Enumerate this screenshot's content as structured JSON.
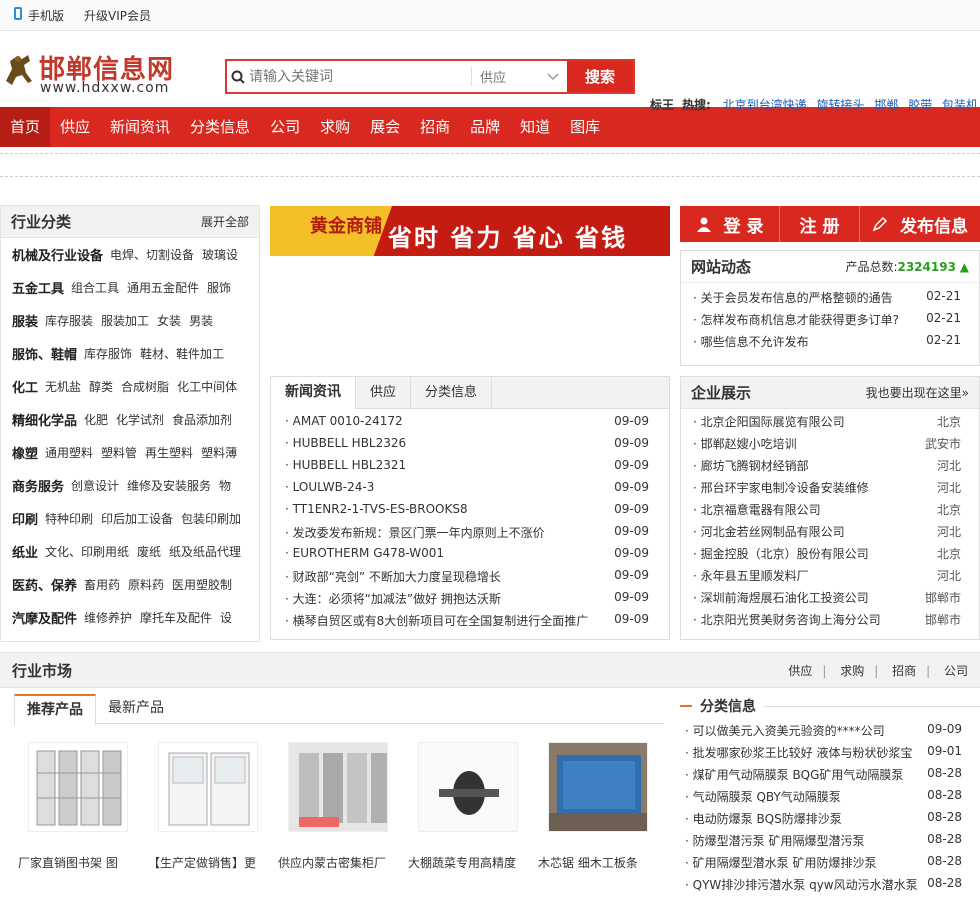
{
  "topbar": {
    "mobile": "手机版",
    "vip": "升级VIP会员"
  },
  "logo": {
    "title": "邯郸信息网",
    "domain": "www.hdxxw.com"
  },
  "search": {
    "placeholder": "请输入关键词",
    "scope": "供应",
    "button": "搜索"
  },
  "hot": {
    "label1": "标王",
    "label2": "热搜:",
    "keywords": [
      "北京到台湾快递",
      "旋转接头",
      "邯郸",
      "胶带",
      "包装机"
    ]
  },
  "nav": [
    "首页",
    "供应",
    "新闻资讯",
    "分类信息",
    "公司",
    "求购",
    "展会",
    "招商",
    "品牌",
    "知道",
    "图库"
  ],
  "categories": {
    "title": "行业分类",
    "expand": "展开全部",
    "rows": [
      {
        "main": "机械及行业设备",
        "subs": [
          "电焊、切割设备",
          "玻璃设"
        ]
      },
      {
        "main": "五金工具",
        "subs": [
          "组合工具",
          "通用五金配件",
          "服饰"
        ]
      },
      {
        "main": "服装",
        "subs": [
          "库存服装",
          "服装加工",
          "女装",
          "男装"
        ]
      },
      {
        "main": "服饰、鞋帽",
        "subs": [
          "库存服饰",
          "鞋材、鞋件加工"
        ]
      },
      {
        "main": "化工",
        "subs": [
          "无机盐",
          "醇类",
          "合成树脂",
          "化工中间体"
        ]
      },
      {
        "main": "精细化学品",
        "subs": [
          "化肥",
          "化学试剂",
          "食品添加剂"
        ]
      },
      {
        "main": "橡塑",
        "subs": [
          "通用塑料",
          "塑料管",
          "再生塑料",
          "塑料薄"
        ]
      },
      {
        "main": "商务服务",
        "subs": [
          "创意设计",
          "维修及安装服务",
          "物"
        ]
      },
      {
        "main": "印刷",
        "subs": [
          "特种印刷",
          "印后加工设备",
          "包装印刷加"
        ]
      },
      {
        "main": "纸业",
        "subs": [
          "文化、印刷用纸",
          "废纸",
          "纸及纸品代理"
        ]
      },
      {
        "main": "医药、保养",
        "subs": [
          "畜用药",
          "原料药",
          "医用塑胶制"
        ]
      },
      {
        "main": "汽摩及配件",
        "subs": [
          "维修养护",
          "摩托车及配件",
          "设"
        ]
      }
    ]
  },
  "banner": {
    "left": "黄金商铺",
    "slogan": "省时 省力 省心 省钱"
  },
  "news": {
    "tabs": [
      "新闻资讯",
      "供应",
      "分类信息"
    ],
    "items": [
      {
        "t": "AMAT 0010-24172",
        "d": "09-09"
      },
      {
        "t": "HUBBELL HBL2326",
        "d": "09-09"
      },
      {
        "t": "HUBBELL HBL2321",
        "d": "09-09"
      },
      {
        "t": "LOULWB-24-3",
        "d": "09-09"
      },
      {
        "t": "TT1ENR2-1-TVS-ES-BROOKS8",
        "d": "09-09"
      },
      {
        "t": "发改委发布新规：景区门票一年内原则上不涨价",
        "d": "09-09"
      },
      {
        "t": "EUROTHERM G478-W001",
        "d": "09-09"
      },
      {
        "t": "财政部“亮剑” 不断加大力度呈现稳增长",
        "d": "09-09"
      },
      {
        "t": "大连：必须将“加减法”做好 拥抱达沃斯",
        "d": "09-09"
      },
      {
        "t": "横琴自贸区或有8大创新项目可在全国复制进行全面推广",
        "d": "09-09"
      }
    ]
  },
  "actions": {
    "login": "登 录",
    "register": "注 册",
    "publish": "发布信息"
  },
  "dynamics": {
    "title": "网站动态",
    "total_label": "产品总数:",
    "total": "2324193",
    "items": [
      {
        "t": "关于会员发布信息的严格整顿的通告",
        "d": "02-21"
      },
      {
        "t": "怎样发布商机信息才能获得更多订单?",
        "d": "02-21"
      },
      {
        "t": "哪些信息不允许发布",
        "d": "02-21"
      }
    ]
  },
  "enterprise": {
    "title": "企业展示",
    "link": "我也要出现在这里»",
    "items": [
      {
        "t": "北京企阳国际展览有限公司",
        "c": "北京"
      },
      {
        "t": "邯郸赵嫂小吃培训",
        "c": "武安市"
      },
      {
        "t": "廊坊飞腾钢材经销部",
        "c": "河北"
      },
      {
        "t": "邢台环宇家电制冷设备安装维修",
        "c": "河北"
      },
      {
        "t": "北京福意電器有限公司",
        "c": "北京"
      },
      {
        "t": "河北金若丝网制品有限公司",
        "c": "河北"
      },
      {
        "t": "掘金控股（北京）股份有限公司",
        "c": "北京"
      },
      {
        "t": "永年县五里顺发料厂",
        "c": "河北"
      },
      {
        "t": "深圳前海煜展石油化工投资公司",
        "c": "邯郸市"
      },
      {
        "t": "北京阳光贯美财务咨询上海分公司",
        "c": "邯郸市"
      }
    ]
  },
  "market": {
    "title": "行业市场",
    "links": [
      "供应",
      "求购",
      "招商",
      "公司"
    ]
  },
  "products": {
    "tabs": [
      "推荐产品",
      "最新产品"
    ],
    "items": [
      "厂家直销图书架 图",
      "【生产定做销售】更",
      "供应内蒙古密集柜厂",
      "大棚蔬菜专用高精度",
      "木芯锯 细木工板条"
    ]
  },
  "classified": {
    "title": "分类信息",
    "items": [
      {
        "t": "可以做美元入资美元验资的****公司",
        "d": "09-09"
      },
      {
        "t": "批发哪家砂浆王比较好 液体与粉状砂浆宝",
        "d": "09-01"
      },
      {
        "t": "煤矿用气动隔膜泵 BQG矿用气动隔膜泵",
        "d": "08-28"
      },
      {
        "t": "气动隔膜泵 QBY气动隔膜泵",
        "d": "08-28"
      },
      {
        "t": "电动防爆泵 BQS防爆排沙泵",
        "d": "08-28"
      },
      {
        "t": "防爆型潜污泵 矿用隔爆型潜污泵",
        "d": "08-28"
      },
      {
        "t": "矿用隔爆型潜水泵 矿用防爆排沙泵",
        "d": "08-28"
      },
      {
        "t": "QYW排沙排污潜水泵 qyw风动污水潜水泵",
        "d": "08-28"
      }
    ]
  },
  "colors": {
    "brand": "#d8281f",
    "accent": "#e8742a",
    "link": "#1a5bb8",
    "green": "#2a9c22"
  }
}
